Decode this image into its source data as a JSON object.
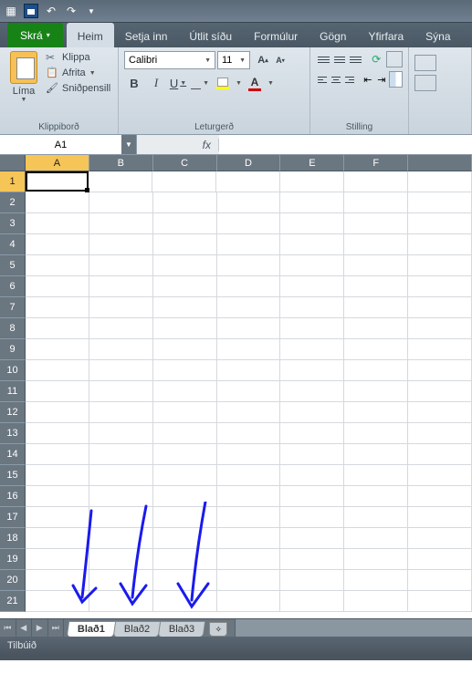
{
  "qat": {
    "save": "save",
    "undo": "undo",
    "redo": "redo"
  },
  "tabs": {
    "file": "Skrá",
    "items": [
      "Heim",
      "Setja inn",
      "Útlit síðu",
      "Formúlur",
      "Gögn",
      "Yfirfara",
      "Sýna"
    ],
    "active": 0
  },
  "clipboard": {
    "paste": "Líma",
    "cut": "Klippa",
    "copy": "Afrita",
    "format_painter": "Sniðpensill",
    "label": "Klippiborð"
  },
  "font": {
    "name": "Calibri",
    "size": "11",
    "bold": "B",
    "italic": "I",
    "underline": "U",
    "font_color_letter": "A",
    "fill_letter": "A",
    "label": "Leturgerð"
  },
  "alignment": {
    "label": "Stilling"
  },
  "formula_bar": {
    "name_box": "A1",
    "fx": "fx",
    "value": ""
  },
  "grid": {
    "columns": [
      "A",
      "B",
      "C",
      "D",
      "E",
      "F"
    ],
    "rows": [
      "1",
      "2",
      "3",
      "4",
      "5",
      "6",
      "7",
      "8",
      "9",
      "10",
      "11",
      "12",
      "13",
      "14",
      "15",
      "16",
      "17",
      "18",
      "19",
      "20",
      "21"
    ],
    "selected": {
      "col": "A",
      "row": "1"
    }
  },
  "sheets": {
    "tabs": [
      "Blað1",
      "Blað2",
      "Blað3"
    ],
    "active": 0
  },
  "status": {
    "ready": "Tilbúið"
  }
}
